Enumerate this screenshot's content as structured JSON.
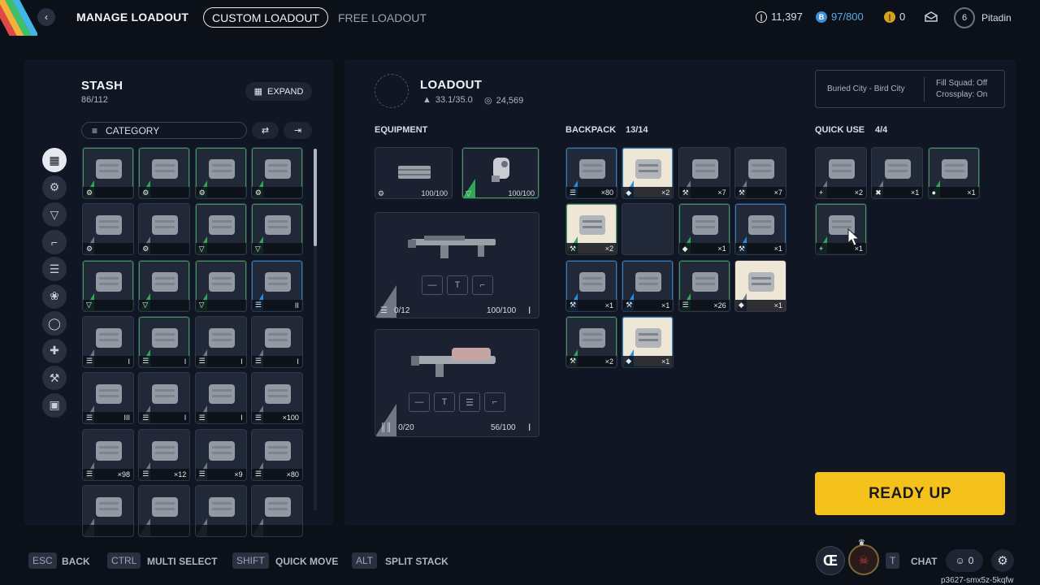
{
  "topbar": {
    "title": "MANAGE LOADOUT",
    "tabs": [
      {
        "label": "CUSTOM LOADOUT",
        "active": true
      },
      {
        "label": "FREE LOADOUT",
        "active": false
      }
    ],
    "credits": "11,397",
    "tokens": "97/800",
    "coins": "0",
    "level": "6",
    "username": "Pitadin"
  },
  "stash": {
    "title": "STASH",
    "capacity": "86/112",
    "expand_label": "EXPAND",
    "category_label": "CATEGORY",
    "side_icons": [
      "grid-icon",
      "attachment-icon",
      "shield-icon",
      "weapon-icon",
      "ammo-icon",
      "gear-cluster-icon",
      "ring-icon",
      "medkit-icon",
      "wrench-icon",
      "box-icon"
    ],
    "items": [
      {
        "rarity": "green",
        "icon": "attachment-icon",
        "count": ""
      },
      {
        "rarity": "green",
        "icon": "attachment-icon",
        "count": ""
      },
      {
        "rarity": "green",
        "icon": "attachment-icon",
        "count": ""
      },
      {
        "rarity": "green",
        "icon": "attachment-icon",
        "count": ""
      },
      {
        "rarity": "gray",
        "icon": "attachment-icon",
        "count": ""
      },
      {
        "rarity": "gray",
        "icon": "attachment-icon",
        "count": ""
      },
      {
        "rarity": "green",
        "icon": "shield-icon",
        "count": ""
      },
      {
        "rarity": "green",
        "icon": "shield-icon",
        "count": ""
      },
      {
        "rarity": "green",
        "icon": "shield-icon",
        "count": ""
      },
      {
        "rarity": "green",
        "icon": "shield-icon",
        "count": ""
      },
      {
        "rarity": "green",
        "icon": "shield-icon",
        "count": ""
      },
      {
        "rarity": "blue",
        "icon": "ammo-icon",
        "count": "II"
      },
      {
        "rarity": "gray",
        "icon": "ammo-icon",
        "count": "I"
      },
      {
        "rarity": "green",
        "icon": "ammo-icon",
        "count": "I"
      },
      {
        "rarity": "gray",
        "icon": "ammo-icon",
        "count": "I"
      },
      {
        "rarity": "gray",
        "icon": "ammo-icon",
        "count": "I"
      },
      {
        "rarity": "gray",
        "icon": "ammo-icon",
        "count": "III"
      },
      {
        "rarity": "gray",
        "icon": "ammo-icon",
        "count": "I"
      },
      {
        "rarity": "gray",
        "icon": "ammo-icon",
        "count": "I"
      },
      {
        "rarity": "gray",
        "icon": "ammo-icon",
        "count": "×100"
      },
      {
        "rarity": "gray",
        "icon": "ammo-icon",
        "count": "×98"
      },
      {
        "rarity": "gray",
        "icon": "ammo-icon",
        "count": "×12"
      },
      {
        "rarity": "gray",
        "icon": "ammo-icon",
        "count": "×9"
      },
      {
        "rarity": "gray",
        "icon": "ammo-icon",
        "count": "×80"
      },
      {
        "rarity": "gray",
        "icon": "",
        "count": ""
      },
      {
        "rarity": "gray",
        "icon": "",
        "count": ""
      },
      {
        "rarity": "gray",
        "icon": "",
        "count": ""
      },
      {
        "rarity": "gray",
        "icon": "",
        "count": ""
      }
    ]
  },
  "loadout": {
    "title": "LOADOUT",
    "weight": "33.1/35.0",
    "value": "24,569",
    "map": "Buried City - Bird City",
    "fill_squad": "Fill Squad: Off",
    "crossplay": "Crossplay: On",
    "equipment_label": "EQUIPMENT",
    "augment_durability": "100/100",
    "shield_durability": "100/100",
    "weapon1_ammo": "0/12",
    "weapon1_durability": "100/100",
    "weapon2_ammo": "0/20",
    "weapon2_durability": "56/100",
    "backpack_label": "BACKPACK",
    "backpack_count": "13/14",
    "quickuse_label": "QUICK USE",
    "quickuse_count": "4/4",
    "backpack": [
      {
        "rarity": "blue",
        "icon": "ammo-icon",
        "count": "×80",
        "cream": false
      },
      {
        "rarity": "blue",
        "icon": "gem-icon",
        "count": "×2",
        "cream": true
      },
      {
        "rarity": "gray",
        "icon": "wrench-icon",
        "count": "×7",
        "cream": false
      },
      {
        "rarity": "gray",
        "icon": "wrench-icon",
        "count": "×7",
        "cream": false
      },
      {
        "rarity": "green",
        "icon": "wrench-icon",
        "count": "×2",
        "cream": true
      },
      {
        "rarity": "none",
        "icon": "",
        "count": "",
        "cream": false
      },
      {
        "rarity": "green",
        "icon": "gem-icon",
        "count": "×1",
        "cream": false
      },
      {
        "rarity": "blue",
        "icon": "wrench-icon",
        "count": "×1",
        "cream": false
      },
      {
        "rarity": "blue",
        "icon": "wrench-icon",
        "count": "×1",
        "cream": false
      },
      {
        "rarity": "blue",
        "icon": "wrench-icon",
        "count": "×1",
        "cream": false
      },
      {
        "rarity": "green",
        "icon": "ammo-icon",
        "count": "×26",
        "cream": false
      },
      {
        "rarity": "gray",
        "icon": "gem-icon",
        "count": "×1",
        "cream": true
      },
      {
        "rarity": "green",
        "icon": "wrench-icon",
        "count": "×2",
        "cream": false
      },
      {
        "rarity": "blue",
        "icon": "gem-icon",
        "count": "×1",
        "cream": true
      }
    ],
    "quickuse": [
      {
        "rarity": "gray",
        "icon": "plus-icon",
        "count": "×2"
      },
      {
        "rarity": "gray",
        "icon": "cross-tools-icon",
        "count": "×1"
      },
      {
        "rarity": "green",
        "icon": "grenade-icon",
        "count": "×1"
      },
      {
        "rarity": "green",
        "icon": "plus-icon",
        "count": "×1"
      }
    ]
  },
  "ready_label": "READY UP",
  "hints": [
    {
      "key": "ESC",
      "label": "BACK"
    },
    {
      "key": "CTRL",
      "label": "MULTI SELECT"
    },
    {
      "key": "SHIFT",
      "label": "QUICK MOVE"
    },
    {
      "key": "ALT",
      "label": "SPLIT STACK"
    }
  ],
  "chat": {
    "key": "T",
    "label": "CHAT",
    "friends": "0"
  },
  "build_id": "p3627-smx5z-5kqfw"
}
